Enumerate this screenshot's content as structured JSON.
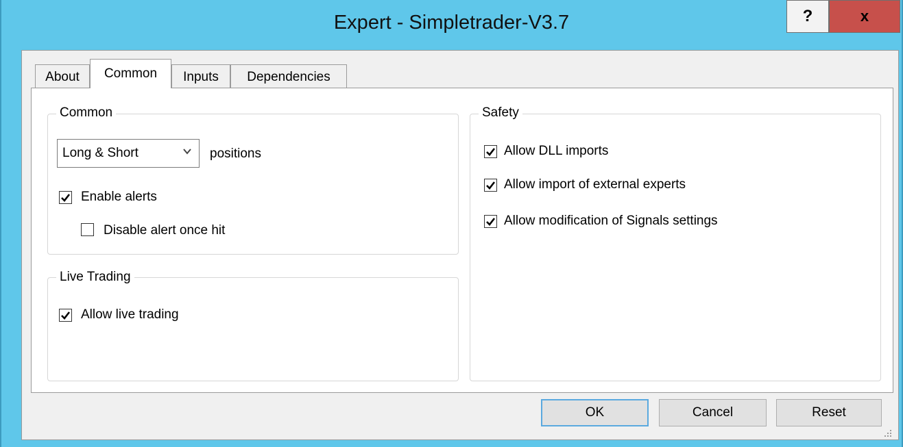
{
  "window": {
    "title": "Expert - Simpletrader-V3.7",
    "help_label": "?",
    "close_label": "x"
  },
  "tabs": [
    {
      "label": "About",
      "active": false
    },
    {
      "label": "Common",
      "active": true
    },
    {
      "label": "Inputs",
      "active": false
    },
    {
      "label": "Dependencies",
      "active": false
    }
  ],
  "common_group": {
    "title": "Common",
    "positions_select": {
      "value": "Long & Short"
    },
    "positions_label": "positions",
    "enable_alerts": {
      "label": "Enable alerts",
      "checked": true
    },
    "disable_alert_once_hit": {
      "label": "Disable alert once hit",
      "checked": false
    }
  },
  "live_trading_group": {
    "title": "Live Trading",
    "allow_live_trading": {
      "label": "Allow live trading",
      "checked": true
    }
  },
  "safety_group": {
    "title": "Safety",
    "allow_dll_imports": {
      "label": "Allow DLL imports",
      "checked": true
    },
    "allow_import_external_experts": {
      "label": "Allow import of external experts",
      "checked": true
    },
    "allow_modify_signals": {
      "label": "Allow modification of Signals settings",
      "checked": true
    }
  },
  "buttons": {
    "ok": "OK",
    "cancel": "Cancel",
    "reset": "Reset"
  },
  "colors": {
    "titlebar": "#5fc7ea",
    "close_button": "#c7504b",
    "dialog_bg": "#f0f0f0"
  }
}
